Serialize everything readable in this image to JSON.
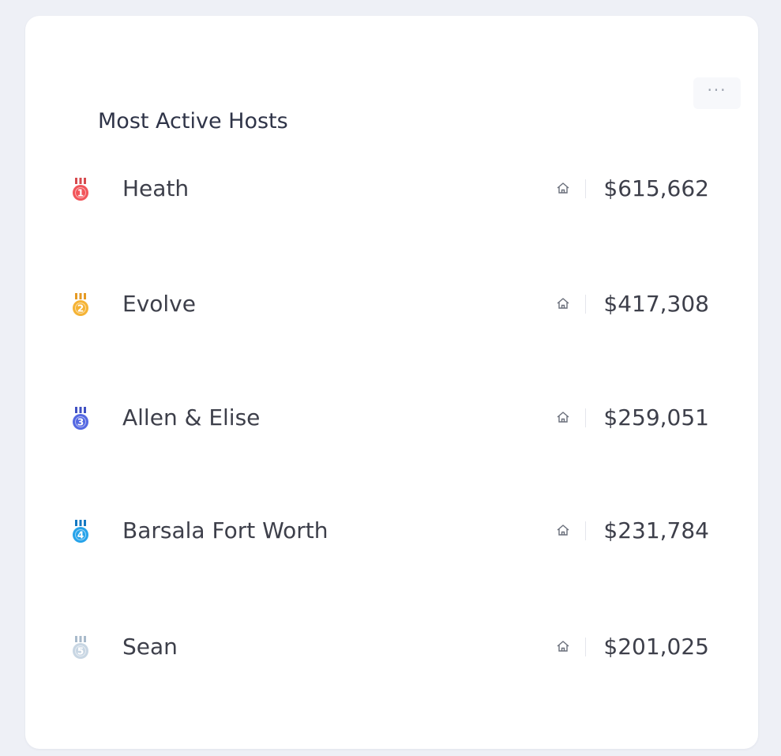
{
  "card": {
    "title": "Most Active Hosts",
    "more_label": "···"
  },
  "hosts": [
    {
      "rank": "1",
      "name": "Heath",
      "revenue": "$615,662",
      "medal_color": "#f2555a",
      "ribbon_color": "#d64a4e",
      "icon": "house-icon"
    },
    {
      "rank": "2",
      "name": "Evolve",
      "revenue": "$417,308",
      "medal_color": "#f5b335",
      "ribbon_color": "#e59a24",
      "icon": "house-icon"
    },
    {
      "rank": "3",
      "name": "Allen & Elise",
      "revenue": "$259,051",
      "medal_color": "#5468e2",
      "ribbon_color": "#3f50c2",
      "icon": "house-icon"
    },
    {
      "rank": "4",
      "name": "Barsala Fort Worth",
      "revenue": "$231,784",
      "medal_color": "#26a3ea",
      "ribbon_color": "#1479c2",
      "icon": "house-icon"
    },
    {
      "rank": "5",
      "name": "Sean",
      "revenue": "$201,025",
      "medal_color": "#c8d6e3",
      "ribbon_color": "#a8bacb",
      "icon": "house-icon"
    }
  ]
}
